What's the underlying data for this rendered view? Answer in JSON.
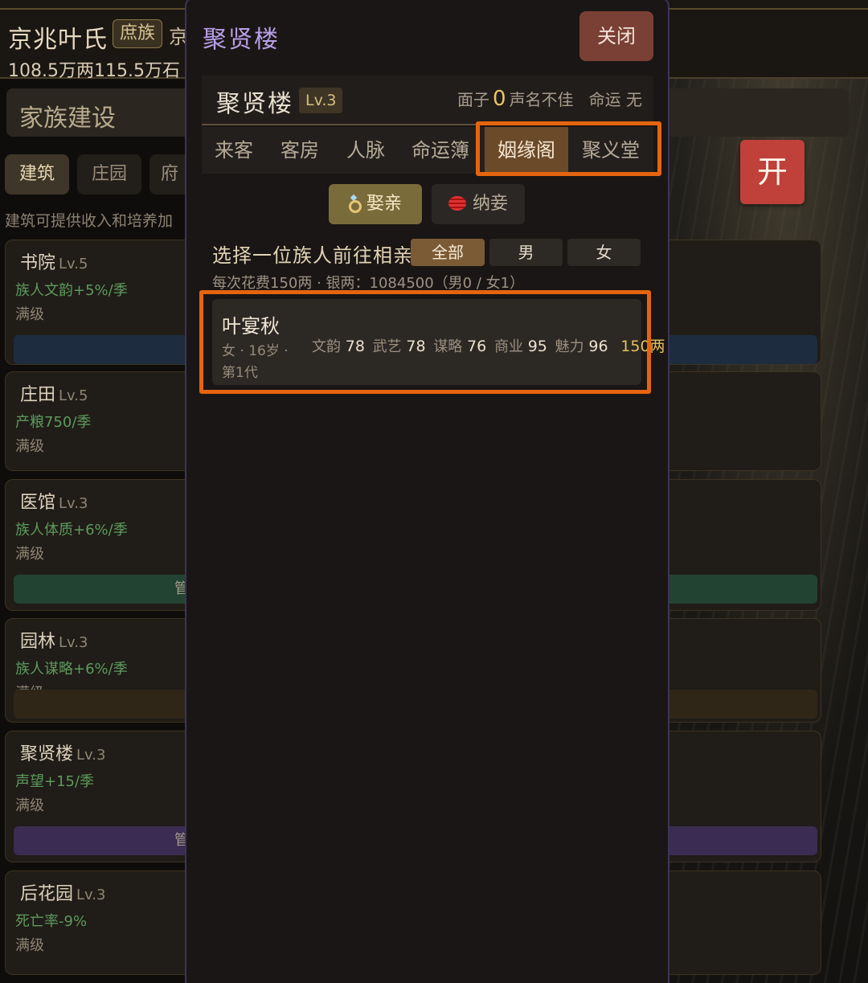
{
  "background": {
    "family_name": "京兆叶氏",
    "family_rank": "庶族",
    "family_trail": "京",
    "stats": "108.5万两115.5万石",
    "section_title": "家族建设",
    "tabs": [
      "建筑",
      "庄园",
      "府"
    ],
    "hint": "建筑可提供收入和培养加",
    "buildings": [
      {
        "name": "书院",
        "level": "Lv.5",
        "effect": "族人文韵+5%/季",
        "status": "满级",
        "button": ""
      },
      {
        "name": "庄田",
        "level": "Lv.5",
        "effect": "产粮750/季",
        "status": "满级",
        "button": ""
      },
      {
        "name": "医馆",
        "level": "Lv.3",
        "effect": "族人体质+6%/季",
        "status": "满级",
        "button": "管"
      },
      {
        "name": "园林",
        "level": "Lv.3",
        "effect": "族人谋略+6%/季",
        "status": "满级",
        "button": ""
      },
      {
        "name": "聚贤楼",
        "level": "Lv.3",
        "effect": "声望+15/季",
        "status": "满级",
        "button": "管"
      },
      {
        "name": "后花园",
        "level": "Lv.3",
        "effect": "死亡率-9%",
        "status": "满级",
        "button": ""
      }
    ],
    "open_button": "开"
  },
  "modal": {
    "title": "聚贤楼",
    "close_label": "关闭",
    "building": {
      "name": "聚贤楼",
      "level": "Lv.3",
      "face_label": "面子",
      "face_value": "0",
      "reputation": "声名不佳",
      "fate_label": "命运",
      "fate_value": "无"
    },
    "tabs": [
      "来客",
      "客房",
      "人脉",
      "命运簿",
      "姻缘阁",
      "聚义堂"
    ],
    "active_tab": "姻缘阁",
    "modes": {
      "marry": "娶亲",
      "concubine": "纳妾"
    },
    "prompt": "选择一位族人前往相亲",
    "filters": [
      "全部",
      "男",
      "女"
    ],
    "cost_line": "每次花费150两 · 银两：1084500（男0 / 女1）",
    "member": {
      "name": "叶宴秋",
      "meta": "女 · 16岁 ·",
      "generation": "第1代",
      "stats": [
        {
          "label": "文韵",
          "value": "78"
        },
        {
          "label": "武艺",
          "value": "78"
        },
        {
          "label": "谋略",
          "value": "76"
        },
        {
          "label": "商业",
          "value": "95"
        },
        {
          "label": "魅力",
          "value": "96"
        }
      ],
      "cost": "150两"
    }
  },
  "colors": {
    "modal_title": "#b89fe6",
    "highlight": "#e6640e",
    "effect_green": "#5c9a5e",
    "gold": "#e6c05a",
    "open_button": "#c0403a"
  }
}
